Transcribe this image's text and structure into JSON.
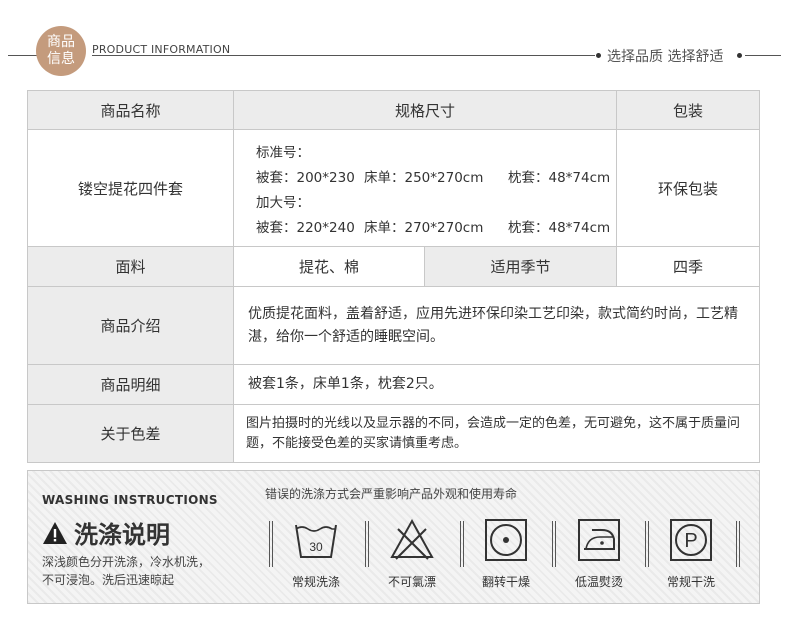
{
  "header": {
    "badge_line1": "商品",
    "badge_line2": "信息",
    "english": "PRODUCT INFORMATION",
    "slogan": "选择品质  选择舒适",
    "badge_color": "#c49b7d"
  },
  "table": {
    "headers": {
      "name": "商品名称",
      "spec": "规格尺寸",
      "package": "包装"
    },
    "product_name": "镂空提花四件套",
    "sizes": {
      "standard_label": "标准号：",
      "standard_quilt": "被套：200*230",
      "standard_sheet": "床单：250*270cm",
      "standard_pillow": "枕套：48*74cm",
      "large_label": "加大号：",
      "large_quilt": "被套：220*240",
      "large_sheet": "床单：270*270cm",
      "large_pillow": "枕套：48*74cm"
    },
    "package_value": "环保包装",
    "fabric_label": "面料",
    "fabric_value": "提花、棉",
    "season_label": "适用季节",
    "season_value": "四季",
    "intro_label": "商品介绍",
    "intro_text": "优质提花面料，盖着舒适，应用先进环保印染工艺印染，款式简约时尚，工艺精湛，给你一个舒适的睡眠空间。",
    "detail_label": "商品明细",
    "detail_text": "被套1条，床单1条，枕套2只。",
    "color_label": "关于色差",
    "color_text": "图片拍摄时的光线以及显示器的不同，会造成一定的色差，无可避免，这不属于质量问题，不能接受色差的买家请慎重考虑。",
    "header_bg": "#ececec"
  },
  "washing": {
    "english": "WASHING INSTRUCTIONS",
    "title": "洗涤说明",
    "desc_line1": "深浅颜色分开洗涤，冷水机洗，",
    "desc_line2": "不可浸泡。洗后迅速晾起",
    "warning": "错误的洗涤方式会严重影响产品外观和使用寿命",
    "symbols": [
      {
        "icon": "wash-30-icon",
        "label": "常规洗涤",
        "temp": "30"
      },
      {
        "icon": "no-bleach-icon",
        "label": "不可氯漂"
      },
      {
        "icon": "tumble-dry-icon",
        "label": "翻转干燥"
      },
      {
        "icon": "low-iron-icon",
        "label": "低温熨烫"
      },
      {
        "icon": "dry-clean-p-icon",
        "label": "常规干洗",
        "letter": "P"
      }
    ]
  }
}
